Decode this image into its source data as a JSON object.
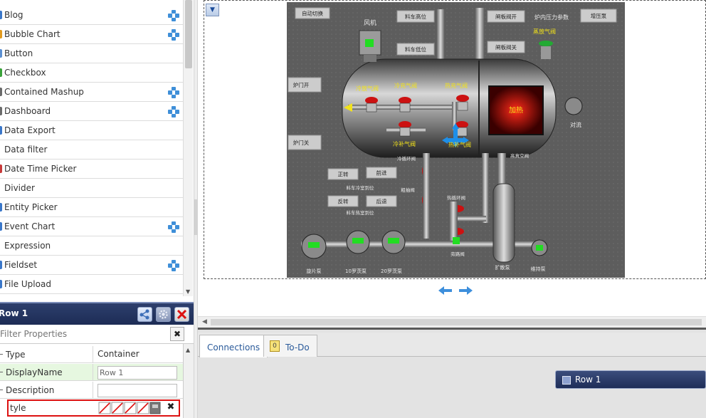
{
  "widgets": {
    "items": [
      {
        "label": "Blog",
        "mashup": true,
        "color": "#3a77c9"
      },
      {
        "label": "Bubble Chart",
        "mashup": true,
        "color": "#e29a1e"
      },
      {
        "label": "Button",
        "mashup": false,
        "color": "#5b8fd1"
      },
      {
        "label": "Checkbox",
        "mashup": false,
        "color": "#3aa23a"
      },
      {
        "label": "Contained Mashup",
        "mashup": true,
        "color": "#6b6b6b"
      },
      {
        "label": "Dashboard",
        "mashup": true,
        "color": "#6b6b6b"
      },
      {
        "label": "Data Export",
        "mashup": false,
        "color": "#3a77c9"
      },
      {
        "label": "Data filter",
        "mashup": false,
        "color": "#ffffff"
      },
      {
        "label": "Date Time Picker",
        "mashup": false,
        "color": "#c83a3a"
      },
      {
        "label": "Divider",
        "mashup": false,
        "color": "#ffffff"
      },
      {
        "label": "Entity Picker",
        "mashup": false,
        "color": "#3a77c9"
      },
      {
        "label": "Event Chart",
        "mashup": true,
        "color": "#3a77c9"
      },
      {
        "label": "Expression",
        "mashup": false,
        "color": "#ffffff"
      },
      {
        "label": "Fieldset",
        "mashup": true,
        "color": "#3a77c9"
      },
      {
        "label": "File Upload",
        "mashup": false,
        "color": "#3a77c9"
      }
    ]
  },
  "properties": {
    "title": "Row 1",
    "filter_placeholder": "Filter Properties",
    "rows": {
      "type": {
        "key": "Type",
        "value": "Container"
      },
      "displayname": {
        "key": "DisplayName",
        "value": "Row 1"
      },
      "description": {
        "key": "Description",
        "value": ""
      },
      "style": {
        "key": "tyle"
      }
    }
  },
  "scada": {
    "buttons": {
      "auto_switch": "自动切换",
      "feed_high": "料车高位",
      "feed_low": "料车低位",
      "valve_open": "闸板阀开",
      "valve_close": "闸板阀关",
      "boost_pump": "增压泵",
      "door_open": "炉门开",
      "door_close": "炉门关",
      "forward": "正转",
      "advance": "前进",
      "reverse": "反转",
      "backward": "后退"
    },
    "labels": {
      "fan": "风机",
      "furnace_pressure": "炉内压力参数",
      "steam_valve": "蒸放气阀",
      "cold_release_valve": "冷放气阀",
      "cold_fill_valve": "冷充气阀",
      "hot_fill_valve": "热充气阀",
      "cold_make_up_valve": "冷补气阀",
      "hot_make_up_valve": "热补气阀",
      "heating": "加热",
      "convection": "对流",
      "cart_cold_pos": "料车冷室到位",
      "cart_hot_pos": "料车热室到位",
      "hot_circ_valve": "热循环阀",
      "cold_circ_valve": "冷循环阀",
      "hot_vac_valve": "高真空阀",
      "rough_valve": "粗抽阀",
      "bypass_valve": "旁路阀",
      "rotary_pump": "旋片泵",
      "roots_pump_10": "10罗茨泵",
      "roots_pump_20": "20罗茨泵",
      "diffusion_pump": "扩散泵",
      "maintain_pump": "维持泵"
    },
    "colors": {
      "background": "#5e5e5e",
      "valve": "#cc1111",
      "indicator": "#22dd22",
      "label": "#f2e21a"
    }
  },
  "tabs": [
    {
      "label": "Connections",
      "active": true
    },
    {
      "label": "To-Do",
      "active": false
    }
  ],
  "bottom": {
    "row_chip": "Row 1"
  },
  "icons": {
    "mashup": "mashup-icon",
    "prop_header": [
      "share-icon",
      "gear-icon",
      "close-icon"
    ],
    "collapse": "collapse-arrow-icon",
    "nav": [
      "arrow-left-icon",
      "arrow-right-icon"
    ]
  }
}
